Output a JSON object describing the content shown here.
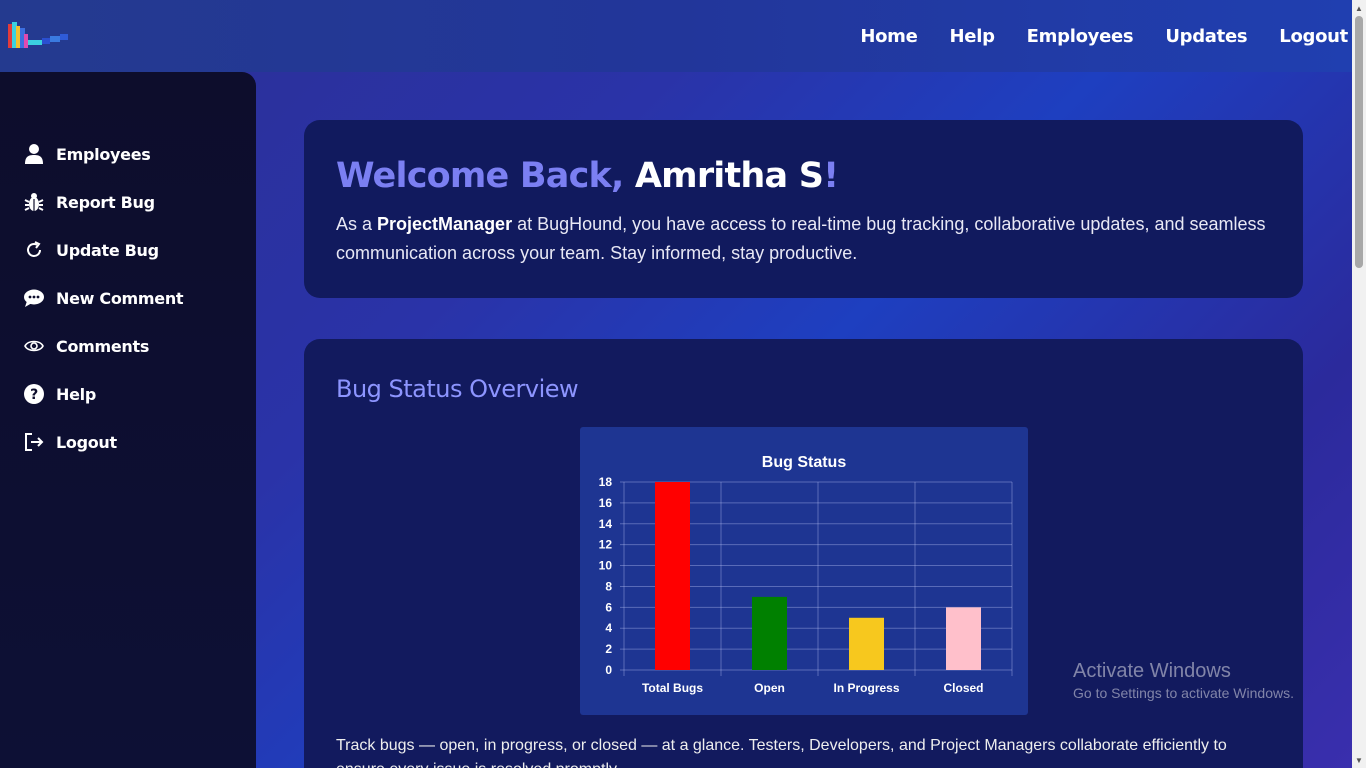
{
  "nav": {
    "home": "Home",
    "help": "Help",
    "employees": "Employees",
    "updates": "Updates",
    "logout": "Logout"
  },
  "sidebar": {
    "items": [
      {
        "label": "Employees",
        "icon": "user-icon"
      },
      {
        "label": "Report Bug",
        "icon": "bug-icon"
      },
      {
        "label": "Update Bug",
        "icon": "refresh-icon"
      },
      {
        "label": "New Comment",
        "icon": "comment-icon"
      },
      {
        "label": "Comments",
        "icon": "eye-icon"
      },
      {
        "label": "Help",
        "icon": "question-icon"
      },
      {
        "label": "Logout",
        "icon": "logout-icon"
      }
    ]
  },
  "welcome": {
    "greeting": "Welcome Back, ",
    "name": "Amritha S",
    "exclaim": "!",
    "text_prefix": "As a ",
    "role": "ProjectManager",
    "text_suffix": " at BugHound, you have access to real-time bug tracking, collaborative updates, and seamless communication across your team. Stay informed, stay productive."
  },
  "overview": {
    "title": "Bug Status Overview",
    "description": "Track bugs — open, in progress, or closed — at a glance. Testers, Developers, and Project Managers collaborate efficiently to ensure every issue is resolved promptly."
  },
  "chart_data": {
    "type": "bar",
    "title": "Bug Status",
    "categories": [
      "Total Bugs",
      "Open",
      "In Progress",
      "Closed"
    ],
    "values": [
      18,
      7,
      5,
      6
    ],
    "colors": [
      "#ff0000",
      "#008000",
      "#f7c81e",
      "#ffc0cb"
    ],
    "ylim": [
      0,
      18
    ],
    "yticks": [
      0,
      2,
      4,
      6,
      8,
      10,
      12,
      14,
      16,
      18
    ],
    "xlabel": "",
    "ylabel": "",
    "grid": true
  },
  "watermark": {
    "line1": "Activate Windows",
    "line2": "Go to Settings to activate Windows."
  }
}
